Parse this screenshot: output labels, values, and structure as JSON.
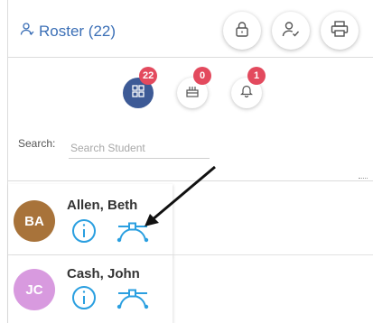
{
  "header": {
    "title": "Roster (22)"
  },
  "filters": [
    {
      "icon": "grid-icon",
      "count": "22",
      "active": true
    },
    {
      "icon": "birthday-cake-icon",
      "count": "0",
      "active": false
    },
    {
      "icon": "bell-icon",
      "count": "1",
      "active": false
    }
  ],
  "search": {
    "label": "Search:",
    "placeholder": "Search Student",
    "value": ""
  },
  "students": [
    {
      "initials": "BA",
      "name": "Allen, Beth",
      "avatar_color": "#a8733a"
    },
    {
      "initials": "JC",
      "name": "Cash, John",
      "avatar_color": "#d89adf"
    }
  ],
  "colors": {
    "accent": "#3b6fb6",
    "icon_blue": "#2a9fe0",
    "badge_red": "#e34a5e",
    "active_filter": "#3d5a96"
  }
}
